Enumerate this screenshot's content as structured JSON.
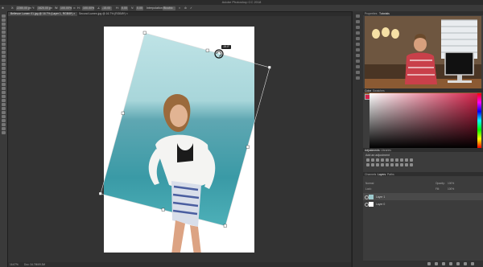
{
  "app": {
    "title": "Adobe Photoshop CC 2018"
  },
  "options_bar": {
    "x_label": "X:",
    "x_value": "2280.00 px",
    "y_label": "Y:",
    "y_value": "1620.00 px",
    "w_label": "W:",
    "w_value": "100.00%",
    "h_label": "H:",
    "h_value": "100.00%",
    "angle_value": "-15.00",
    "h2_value": "0.00",
    "v2_value": "0.00",
    "interpolation_label": "Interpolation:",
    "interpolation_value": "Bicubic"
  },
  "document_tabs": [
    {
      "label": "Bellevue Lumen 01.jpg @ 16.7% (Layer 1, RGB/8*) ×",
      "active": true
    },
    {
      "label": "Second Lumen.jpg @ 16.7% (RGB/8*) ×",
      "active": false
    }
  ],
  "tooltip": {
    "text": "-15.0°"
  },
  "status_bar": {
    "zoom": "16.67%",
    "doc": "Doc: 34.7M/69.3M"
  },
  "panels": {
    "video_tabs": {
      "tab1": "Properties",
      "tab2": "Tutorials"
    },
    "color_tabs": {
      "tab1": "Color",
      "tab2": "Swatches"
    },
    "adjustments_tabs": {
      "tab1": "Adjustments",
      "tab2": "Libraries"
    },
    "adjustments_hint": "Add an adjustment",
    "layers_tabs": {
      "tab1": "Channels",
      "tab2": "Layers",
      "tab3": "Paths"
    },
    "layers_opts": {
      "blend": "Normal",
      "opacity_label": "Opacity:",
      "opacity": "100%",
      "fill_label": "Fill:",
      "fill": "100%",
      "lock_label": "Lock:"
    },
    "layers": [
      {
        "name": "Layer 1",
        "selected": true
      },
      {
        "name": "Layer 0",
        "selected": false
      }
    ]
  },
  "colors": {
    "accent_red": "#d4224a",
    "canvas_bg": "#ffffff",
    "app_bg": "#282828"
  }
}
